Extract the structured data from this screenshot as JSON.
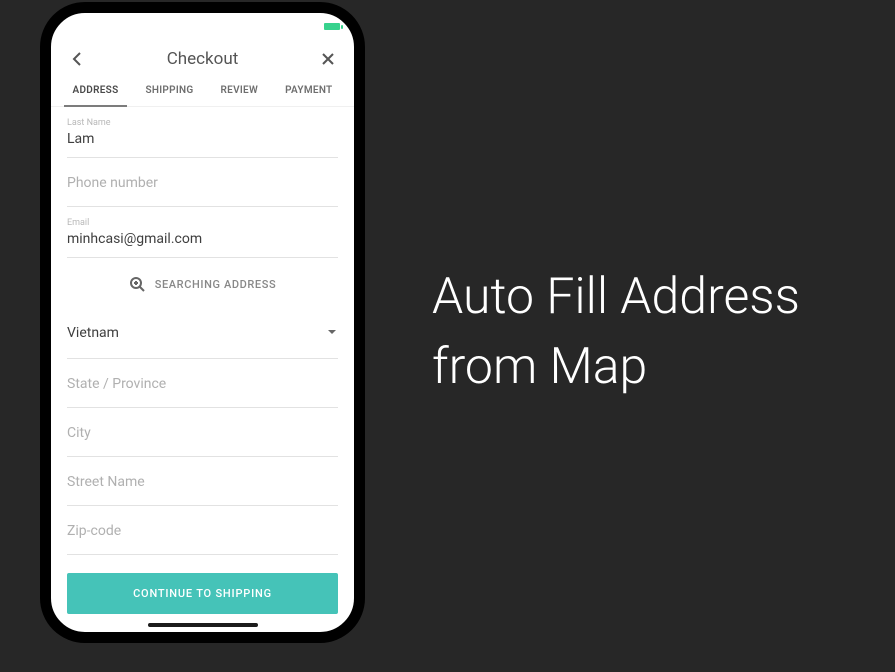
{
  "caption": {
    "line1": "Auto Fill Address",
    "line2": "from Map"
  },
  "header": {
    "title": "Checkout"
  },
  "tabs": {
    "address": "ADDRESS",
    "shipping": "SHIPPING",
    "review": "REVIEW",
    "payment": "PAYMENT"
  },
  "fields": {
    "lastName": {
      "label": "Last Name",
      "value": "Lam"
    },
    "phone": {
      "placeholder": "Phone number"
    },
    "email": {
      "label": "Email",
      "value": "minhcasi@gmail.com"
    },
    "country": {
      "value": "Vietnam"
    },
    "state": {
      "placeholder": "State / Province"
    },
    "city": {
      "placeholder": "City"
    },
    "street": {
      "placeholder": "Street Name"
    },
    "zip": {
      "placeholder": "Zip-code"
    }
  },
  "searchAddress": {
    "label": "SEARCHING ADDRESS"
  },
  "cta": {
    "label": "CONTINUE TO SHIPPING"
  }
}
